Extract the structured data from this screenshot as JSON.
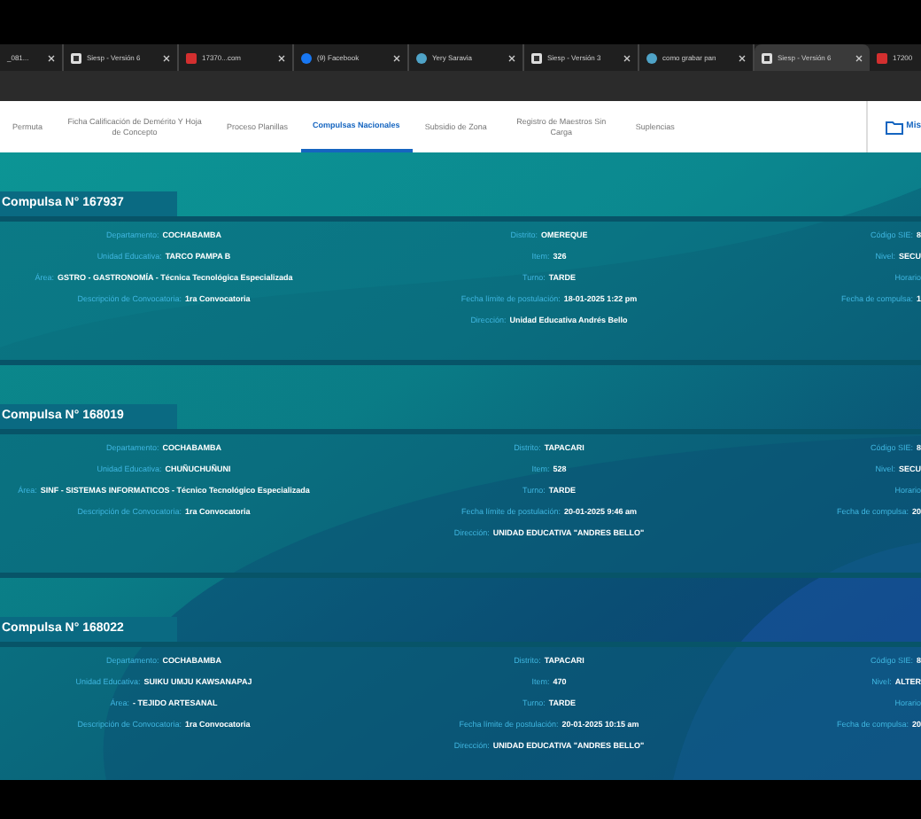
{
  "browser_tabs": [
    {
      "title": "_081...",
      "kind": "plain",
      "selected": false
    },
    {
      "title": "Siesp - Versión 6",
      "kind": "site",
      "selected": false
    },
    {
      "title": "17370...com",
      "kind": "pdf",
      "selected": false
    },
    {
      "title": "(9) Facebook",
      "kind": "social",
      "selected": false
    },
    {
      "title": "Yery Saravia",
      "kind": "web",
      "selected": false
    },
    {
      "title": "Siesp - Versión 3",
      "kind": "site",
      "selected": false
    },
    {
      "title": "como grabar pan",
      "kind": "web",
      "selected": false
    },
    {
      "title": "Siesp - Versión 6",
      "kind": "site",
      "selected": true
    },
    {
      "title": "17200",
      "kind": "pdf",
      "selected": false
    }
  ],
  "nav": {
    "items": [
      {
        "label": "Permuta",
        "selected": false
      },
      {
        "label": "Ficha Calificación de Demérito Y Hoja de Concepto",
        "selected": false
      },
      {
        "label": "Proceso Planillas",
        "selected": false
      },
      {
        "label": "Compulsas Nacionales",
        "selected": true
      },
      {
        "label": "Subsidio de Zona",
        "selected": false
      },
      {
        "label": "Registro de Maestros Sin Carga",
        "selected": false
      },
      {
        "label": "Suplencias",
        "selected": false
      }
    ],
    "right_link": "Mis"
  },
  "compulsas": [
    {
      "title": "Compulsa N° 167937",
      "columns": [
        [
          {
            "label": "Departamento:",
            "value": "COCHABAMBA"
          },
          {
            "label": "Unidad Educativa:",
            "value": "TARCO PAMPA B"
          },
          {
            "label": "Área:",
            "value": "GSTRO - GASTRONOMÍA - Técnica Tecnológica Especializada"
          },
          {
            "label": "Descripción de Convocatoria:",
            "value": "1ra Convocatoria"
          }
        ],
        [
          {
            "label": "Distrito:",
            "value": "OMEREQUE"
          },
          {
            "label": "Item:",
            "value": "326"
          },
          {
            "label": "Turno:",
            "value": "TARDE"
          },
          {
            "label": "Fecha límite de postulación:",
            "value": "18-01-2025 1:22 pm"
          },
          {
            "label": "Dirección:",
            "value": "Unidad Educativa Andrés Bello"
          }
        ],
        [
          {
            "label": "Código SIE:",
            "value": "8"
          },
          {
            "label": "Nivel:",
            "value": "SECU"
          },
          {
            "label": "Horario"
          },
          {
            "label": "Fecha de compulsa:",
            "value": "1"
          }
        ]
      ]
    },
    {
      "title": "Compulsa N° 168019",
      "columns": [
        [
          {
            "label": "Departamento:",
            "value": "COCHABAMBA"
          },
          {
            "label": "Unidad Educativa:",
            "value": "CHUÑUCHUÑUNI"
          },
          {
            "label": "Área:",
            "value": "SINF - SISTEMAS INFORMATICOS - Técnico Tecnológico Especializada"
          },
          {
            "label": "Descripción de Convocatoria:",
            "value": "1ra Convocatoria"
          }
        ],
        [
          {
            "label": "Distrito:",
            "value": "TAPACARI"
          },
          {
            "label": "Item:",
            "value": "528"
          },
          {
            "label": "Turno:",
            "value": "TARDE"
          },
          {
            "label": "Fecha límite de postulación:",
            "value": "20-01-2025 9:46 am"
          },
          {
            "label": "Dirección:",
            "value": "UNIDAD EDUCATIVA \"ANDRES BELLO\""
          }
        ],
        [
          {
            "label": "Código SIE:",
            "value": "8"
          },
          {
            "label": "Nivel:",
            "value": "SECU"
          },
          {
            "label": "Horario"
          },
          {
            "label": "Fecha de compulsa:",
            "value": "20"
          }
        ]
      ]
    },
    {
      "title": "Compulsa N° 168022",
      "columns": [
        [
          {
            "label": "Departamento:",
            "value": "COCHABAMBA"
          },
          {
            "label": "Unidad Educativa:",
            "value": "SUIKU UMJU KAWSANAPAJ"
          },
          {
            "label": "Área:",
            "value": "- TEJIDO ARTESANAL"
          },
          {
            "label": "Descripción de Convocatoria:",
            "value": "1ra Convocatoria"
          }
        ],
        [
          {
            "label": "Distrito:",
            "value": "TAPACARI"
          },
          {
            "label": "Item:",
            "value": "470"
          },
          {
            "label": "Turno:",
            "value": "TARDE"
          },
          {
            "label": "Fecha límite de postulación:",
            "value": "20-01-2025 10:15 am"
          },
          {
            "label": "Dirección:",
            "value": "UNIDAD EDUCATIVA \"ANDRES BELLO\""
          }
        ],
        [
          {
            "label": "Código SIE:",
            "value": "8"
          },
          {
            "label": "Nivel:",
            "value": "ALTER"
          },
          {
            "label": "Horario"
          },
          {
            "label": "Fecha de compulsa:",
            "value": "20"
          }
        ]
      ]
    }
  ]
}
